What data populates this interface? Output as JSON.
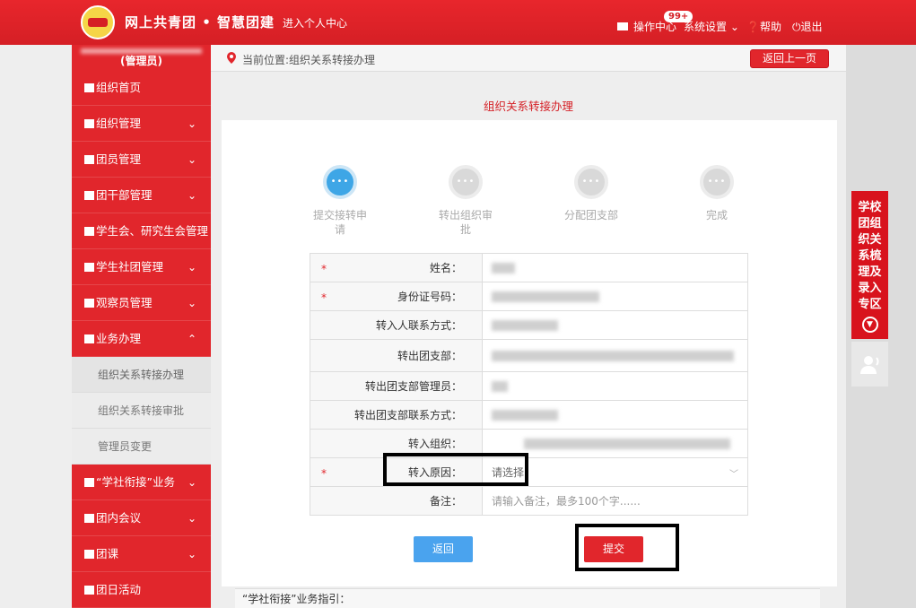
{
  "header": {
    "site_title": "网上共青团 • 智慧团建",
    "personal_center": "进入个人中心",
    "ops_center": "操作中心",
    "ops_badge": "99+",
    "system_settings": "系统设置",
    "help": "帮助",
    "logout": "退出"
  },
  "sidebar": {
    "role": "(管理员)",
    "items": [
      {
        "label": "组织首页",
        "icon": "home-icon",
        "chevron": ""
      },
      {
        "label": "组织管理",
        "icon": "org-icon",
        "chevron": "⌄"
      },
      {
        "label": "团员管理",
        "icon": "users-icon",
        "chevron": "⌄"
      },
      {
        "label": "团干部管理",
        "icon": "users-icon",
        "chevron": "⌄"
      },
      {
        "label": "学生会、研究生会管理",
        "icon": "users-icon",
        "chevron": ""
      },
      {
        "label": "学生社团管理",
        "icon": "users-icon",
        "chevron": "⌄"
      },
      {
        "label": "观察员管理",
        "icon": "users-icon",
        "chevron": "⌄"
      },
      {
        "label": "业务办理",
        "icon": "list-icon",
        "chevron": "⌃"
      }
    ],
    "sub_items": [
      "组织关系转接办理",
      "组织关系转接审批",
      "管理员变更"
    ],
    "items_bottom": [
      {
        "label": "“学社衔接”业务",
        "icon": "list-icon",
        "chevron": "⌄"
      },
      {
        "label": "团内会议",
        "icon": "edit-icon",
        "chevron": "⌄"
      },
      {
        "label": "团课",
        "icon": "folder-icon",
        "chevron": "⌄"
      },
      {
        "label": "团日活动",
        "icon": "refresh-icon",
        "chevron": ""
      }
    ]
  },
  "breadcrumb": {
    "text": "当前位置:组织关系转接办理",
    "back_label": "返回上一页"
  },
  "page_heading": "组织关系转接办理",
  "steps": [
    {
      "label": "提交接转申请",
      "active": true
    },
    {
      "label": "转出组织审批",
      "active": false
    },
    {
      "label": "分配团支部",
      "active": false
    },
    {
      "label": "完成",
      "active": false
    }
  ],
  "form": {
    "rows": [
      {
        "label": "姓名：",
        "required": true
      },
      {
        "label": "身份证号码：",
        "required": true
      },
      {
        "label": "转入人联系方式：",
        "required": false
      },
      {
        "label": "转出团支部：",
        "required": false
      },
      {
        "label": "转出团支部管理员：",
        "required": false
      },
      {
        "label": "转出团支部联系方式：",
        "required": false
      },
      {
        "label": "转入组织：",
        "required": false
      },
      {
        "label": "转入原因：",
        "required": true
      },
      {
        "label": "备注：",
        "required": false
      }
    ],
    "reason_placeholder": "请选择",
    "remark_placeholder": "请输入备注，最多100个字......"
  },
  "buttons": {
    "return_label": "返回",
    "submit_label": "提交"
  },
  "guide_label": "“学社衔接”业务指引：",
  "right_tab": {
    "label": "学校团组织关系梳理及录入专区"
  }
}
